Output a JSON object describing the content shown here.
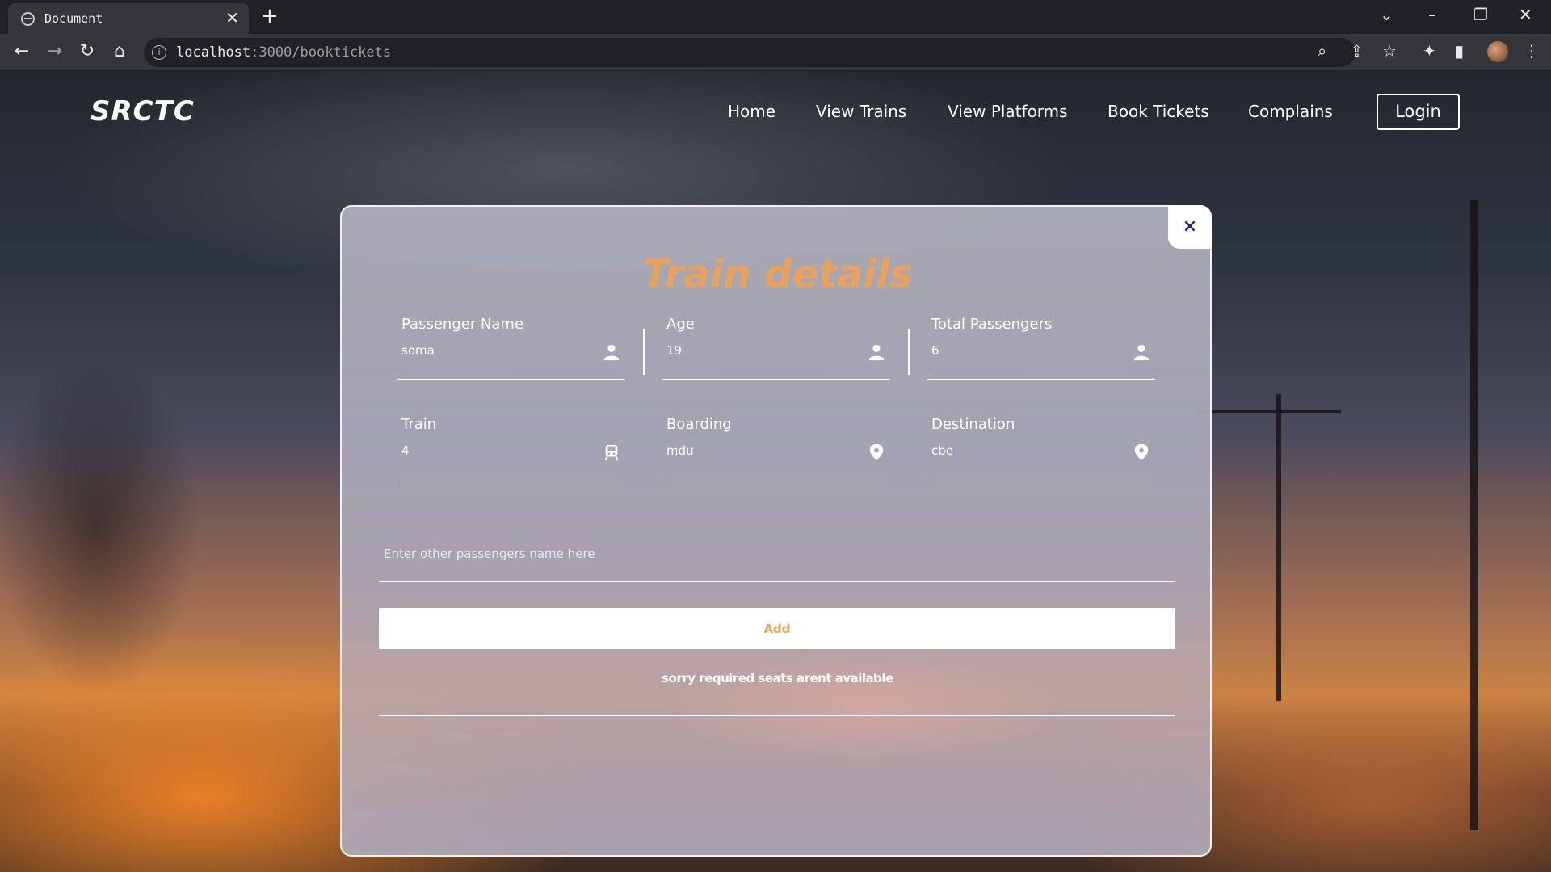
{
  "browser": {
    "tab_title": "Document",
    "url_host": "localhost",
    "url_path": ":3000/booktickets"
  },
  "header": {
    "logo": "SRCTC",
    "nav": [
      "Home",
      "View Trains",
      "View Platforms",
      "Book Tickets",
      "Complains"
    ],
    "login_label": "Login"
  },
  "modal": {
    "title": "Train details",
    "close_label": "×",
    "fields": {
      "passenger_name": {
        "label": "Passenger Name",
        "value": "soma",
        "icon": "user-icon"
      },
      "age": {
        "label": "Age",
        "value": "19",
        "icon": "user-icon"
      },
      "total_passengers": {
        "label": "Total Passengers",
        "value": "6",
        "icon": "user-icon"
      },
      "train": {
        "label": "Train",
        "value": "4",
        "icon": "train-icon"
      },
      "boarding": {
        "label": "Boarding",
        "value": "mdu",
        "icon": "location-pin-icon"
      },
      "destination": {
        "label": "Destination",
        "value": "cbe",
        "icon": "location-pin-icon"
      }
    },
    "other_passengers_placeholder": "Enter other passengers name here",
    "add_label": "Add",
    "message": "sorry required seats arent available"
  },
  "colors": {
    "accent": "#e9a25b",
    "close_icon": "#2b2b6b",
    "text": "#ffffff"
  }
}
